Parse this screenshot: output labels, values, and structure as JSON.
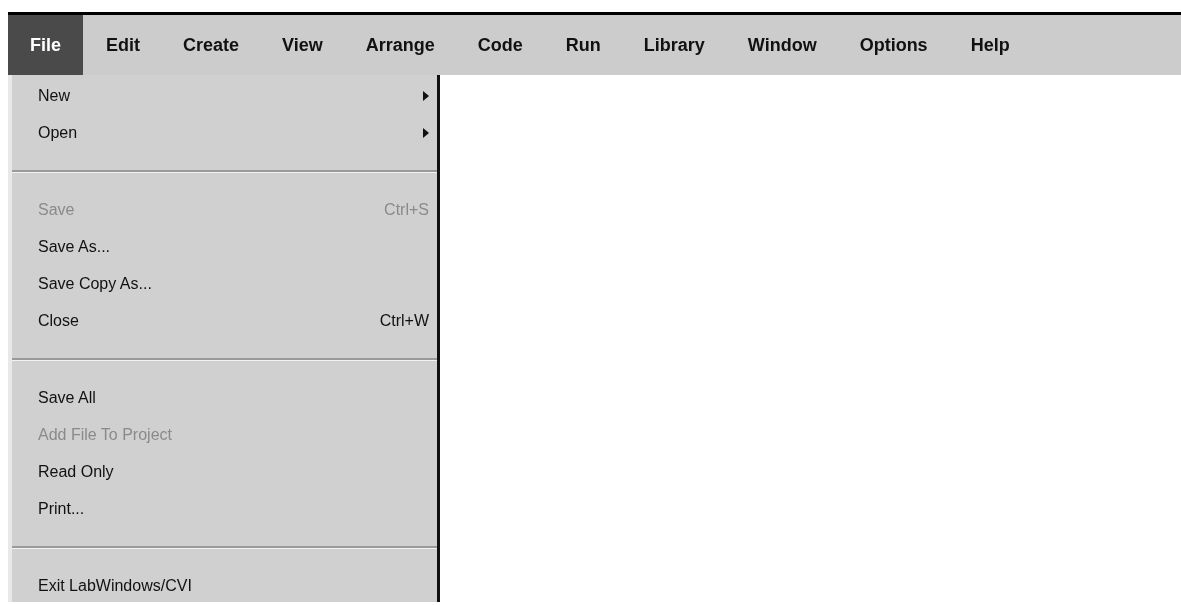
{
  "menu_bar": [
    {
      "label": "File",
      "selected": true
    },
    {
      "label": "Edit",
      "selected": false
    },
    {
      "label": "Create",
      "selected": false
    },
    {
      "label": "View",
      "selected": false
    },
    {
      "label": "Arrange",
      "selected": false
    },
    {
      "label": "Code",
      "selected": false
    },
    {
      "label": "Run",
      "selected": false
    },
    {
      "label": "Library",
      "selected": false
    },
    {
      "label": "Window",
      "selected": false
    },
    {
      "label": "Options",
      "selected": false
    },
    {
      "label": "Help",
      "selected": false
    }
  ],
  "file_menu": [
    {
      "kind": "item",
      "label": "New",
      "disabled": false,
      "submenu": true
    },
    {
      "kind": "item",
      "label": "Open",
      "disabled": false,
      "submenu": true
    },
    {
      "kind": "separator"
    },
    {
      "kind": "item",
      "label": "Save",
      "shortcut": "Ctrl+S",
      "disabled": true,
      "submenu": false
    },
    {
      "kind": "item",
      "label": "Save As...",
      "disabled": false,
      "submenu": false
    },
    {
      "kind": "item",
      "label": "Save Copy As...",
      "disabled": false,
      "submenu": false
    },
    {
      "kind": "item",
      "label": "Close",
      "shortcut": "Ctrl+W",
      "disabled": false,
      "submenu": false
    },
    {
      "kind": "separator"
    },
    {
      "kind": "item",
      "label": "Save All",
      "disabled": false,
      "submenu": false
    },
    {
      "kind": "item",
      "label": "Add File To Project",
      "disabled": true,
      "submenu": false
    },
    {
      "kind": "item",
      "label": "Read Only",
      "disabled": false,
      "submenu": false
    },
    {
      "kind": "item",
      "label": "Print...",
      "disabled": false,
      "submenu": false
    },
    {
      "kind": "separator"
    },
    {
      "kind": "item",
      "label": "Exit LabWindows/CVI",
      "disabled": false,
      "submenu": false
    }
  ]
}
